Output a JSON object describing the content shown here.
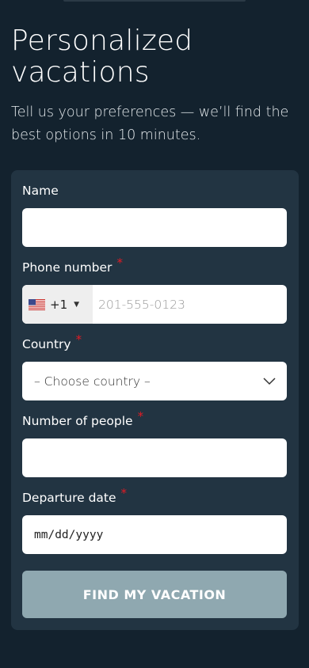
{
  "hero": {
    "title_line1": "Personalized",
    "title_line2": "vacations",
    "subtitle": "Tell us your preferences — we’ll find the best options in 10 minutes."
  },
  "form": {
    "name": {
      "label": "Name",
      "required": false,
      "value": ""
    },
    "phone": {
      "label": "Phone number",
      "required_mark": "*",
      "country_flag": "us-flag-icon",
      "dial_code": "+1",
      "placeholder": "201-555-0123",
      "value": ""
    },
    "country": {
      "label": "Country",
      "required_mark": "*",
      "selected": "– Choose country –"
    },
    "people": {
      "label": "Number of people",
      "required_mark": "*",
      "value": ""
    },
    "departure": {
      "label": "Departure date",
      "required_mark": "*",
      "placeholder": "mm/dd/yyyy"
    },
    "submit_label": "FIND MY VACATION"
  },
  "colors": {
    "background": "#13222e",
    "card": "#223442",
    "required": "#e01b24",
    "button": "#8fa8b0"
  }
}
